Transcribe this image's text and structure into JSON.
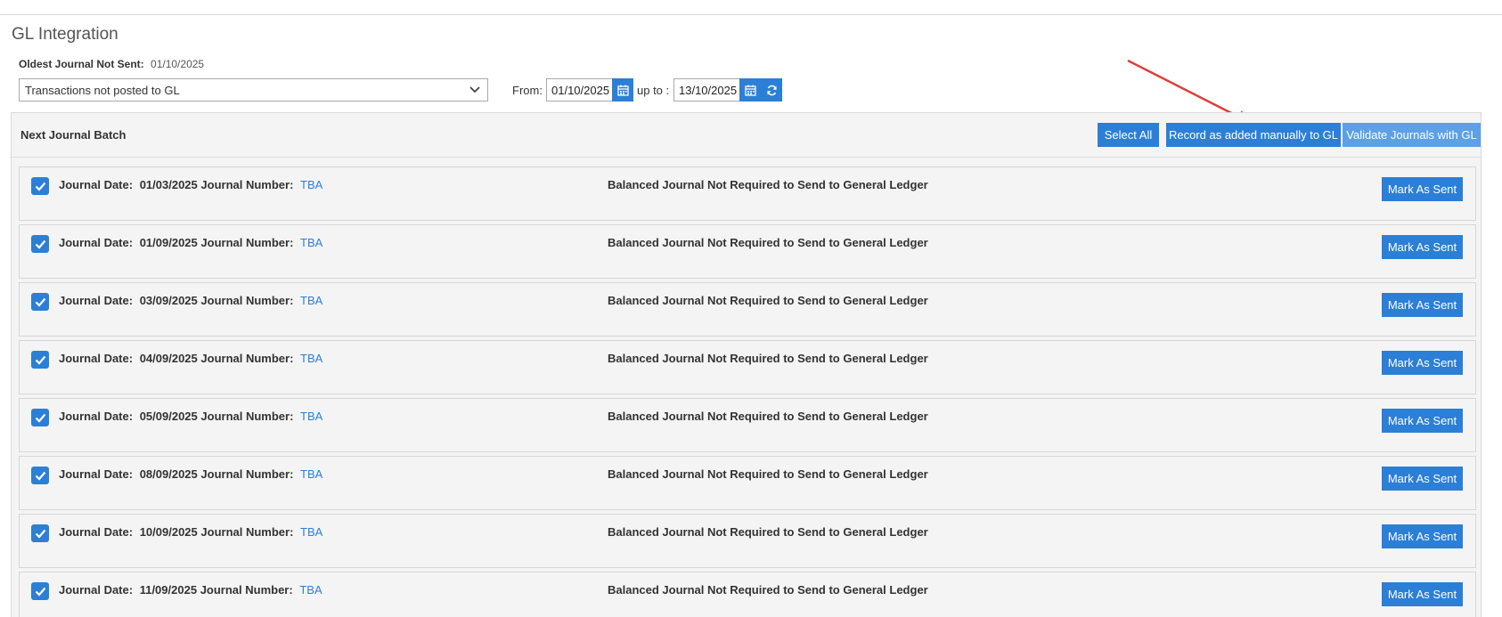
{
  "page": {
    "title": "GL Integration"
  },
  "oldest": {
    "label": "Oldest Journal Not Sent:",
    "value": "01/10/2025"
  },
  "filter": {
    "selected": "Transactions not posted to GL"
  },
  "date_range": {
    "from_label": "From:",
    "from_value": "01/10/2025",
    "upto_label": "up to :",
    "upto_value": "13/10/2025"
  },
  "batch": {
    "title": "Next Journal Batch",
    "select_all": "Select All",
    "record_manual": "Record as added manually to GL",
    "validate": "Validate Journals with GL"
  },
  "row_labels": {
    "date_label": "Journal Date:",
    "number_label": "Journal Number:",
    "mark_label": "Mark As Sent"
  },
  "journals": [
    {
      "date": "01/03/2025",
      "number": "TBA",
      "status": "Balanced Journal Not Required to Send to General Ledger",
      "checked": true
    },
    {
      "date": "01/09/2025",
      "number": "TBA",
      "status": "Balanced Journal Not Required to Send to General Ledger",
      "checked": true
    },
    {
      "date": "03/09/2025",
      "number": "TBA",
      "status": "Balanced Journal Not Required to Send to General Ledger",
      "checked": true
    },
    {
      "date": "04/09/2025",
      "number": "TBA",
      "status": "Balanced Journal Not Required to Send to General Ledger",
      "checked": true
    },
    {
      "date": "05/09/2025",
      "number": "TBA",
      "status": "Balanced Journal Not Required to Send to General Ledger",
      "checked": true
    },
    {
      "date": "08/09/2025",
      "number": "TBA",
      "status": "Balanced Journal Not Required to Send to General Ledger",
      "checked": true
    },
    {
      "date": "10/09/2025",
      "number": "TBA",
      "status": "Balanced Journal Not Required to Send to General Ledger",
      "checked": true
    },
    {
      "date": "11/09/2025",
      "number": "TBA",
      "status": "Balanced Journal Not Required to Send to General Ledger",
      "checked": true
    }
  ],
  "colors": {
    "accent": "#2c7fd6",
    "accent_light": "#5da0e6",
    "annotation_arrow": "#e03c3c"
  },
  "icons": {
    "dropdown": "chevron-down-icon",
    "calendar": "calendar-icon",
    "refresh": "refresh-icon",
    "checkbox": "checkmark-icon"
  }
}
